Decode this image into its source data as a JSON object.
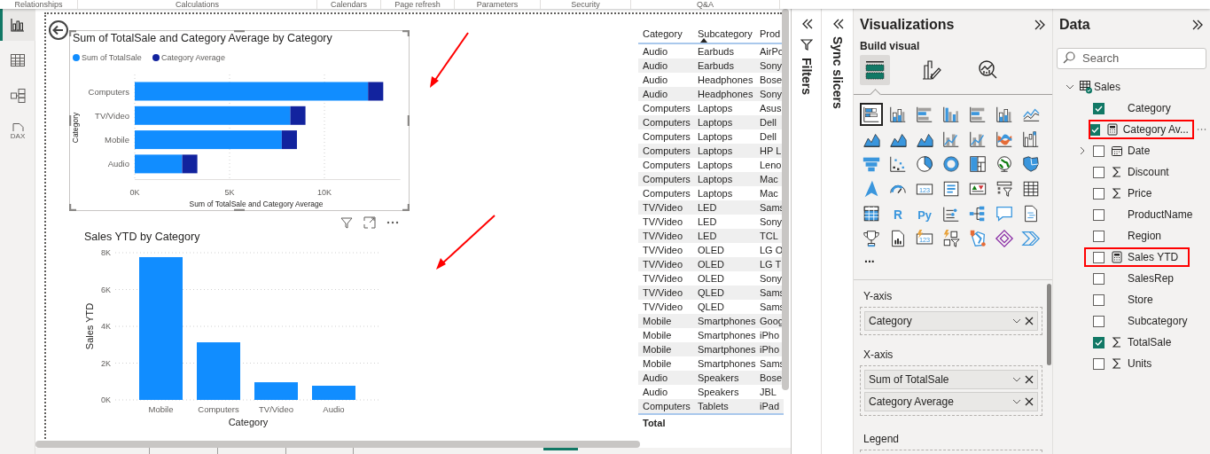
{
  "ribbon_groups": [
    "Relationships",
    "Calculations",
    "Calendars",
    "Page refresh",
    "Parameters",
    "Security",
    "Q&A"
  ],
  "nav": [
    {
      "kind": "report",
      "selected": true
    },
    {
      "kind": "table",
      "selected": false
    },
    {
      "kind": "model",
      "selected": false
    },
    {
      "kind": "dax",
      "label": "DAX",
      "selected": false
    }
  ],
  "report": {
    "visuals": [
      {
        "selected": true,
        "hovered": false,
        "chart_data": {
          "type": "bar",
          "orientation": "horizontal",
          "stacked": true,
          "legend": true,
          "grid": true,
          "xlim": [
            0,
            14000
          ],
          "title": "Sum of TotalSale and Category Average by Category",
          "xlabel": "Sum of TotalSale and Category Average",
          "ylabel": "Category",
          "categories": [
            "Computers",
            "TV/Video",
            "Mobile",
            "Audio"
          ],
          "series": [
            {
              "name": "Sum of TotalSale",
              "color": "#118dff",
              "values": [
                12300,
                8200,
                7750,
                2500
              ]
            },
            {
              "name": "Category Average",
              "color": "#12239e",
              "values": [
                800,
                800,
                800,
                800
              ]
            }
          ],
          "xticks": [
            {
              "value": 0,
              "label": "0K"
            },
            {
              "value": 5000,
              "label": "5K"
            },
            {
              "value": 10000,
              "label": "10K"
            }
          ]
        }
      },
      {
        "selected": false,
        "hovered": true,
        "chart_data": {
          "type": "bar",
          "orientation": "vertical",
          "grid": true,
          "ylim": [
            0,
            8000
          ],
          "title": "Sales YTD by Category",
          "xlabel": "Category",
          "ylabel": "Sales YTD",
          "categories": [
            "Mobile",
            "Computers",
            "TV/Video",
            "Audio"
          ],
          "values": [
            7760,
            3130,
            960,
            770
          ],
          "yticks": [
            {
              "value": 0,
              "label": "0K"
            },
            {
              "value": 2000,
              "label": "2K"
            },
            {
              "value": 4000,
              "label": "4K"
            },
            {
              "value": 6000,
              "label": "6K"
            },
            {
              "value": 8000,
              "label": "8K"
            }
          ]
        }
      }
    ],
    "table": {
      "columns": [
        {
          "label": "Category",
          "sorted": false
        },
        {
          "label": "Subcategory",
          "sorted": true
        },
        {
          "label": "Prod",
          "sorted": false
        }
      ],
      "rows": [
        [
          "Audio",
          "Earbuds",
          "AirPo"
        ],
        [
          "Audio",
          "Earbuds",
          "Sony"
        ],
        [
          "Audio",
          "Headphones",
          "Bose"
        ],
        [
          "Audio",
          "Headphones",
          "Sony"
        ],
        [
          "Computers",
          "Laptops",
          "Asus"
        ],
        [
          "Computers",
          "Laptops",
          "Dell"
        ],
        [
          "Computers",
          "Laptops",
          "Dell"
        ],
        [
          "Computers",
          "Laptops",
          "HP L"
        ],
        [
          "Computers",
          "Laptops",
          "Leno"
        ],
        [
          "Computers",
          "Laptops",
          "Mac"
        ],
        [
          "Computers",
          "Laptops",
          "Mac"
        ],
        [
          "TV/Video",
          "LED",
          "Sams"
        ],
        [
          "TV/Video",
          "LED",
          "Sony"
        ],
        [
          "TV/Video",
          "LED",
          "TCL"
        ],
        [
          "TV/Video",
          "OLED",
          "LG O"
        ],
        [
          "TV/Video",
          "OLED",
          "LG T"
        ],
        [
          "TV/Video",
          "OLED",
          "Sony"
        ],
        [
          "TV/Video",
          "QLED",
          "Sams"
        ],
        [
          "TV/Video",
          "QLED",
          "Sams"
        ],
        [
          "Mobile",
          "Smartphones",
          "Goog"
        ],
        [
          "Mobile",
          "Smartphones",
          "iPho"
        ],
        [
          "Mobile",
          "Smartphones",
          "iPho"
        ],
        [
          "Mobile",
          "Smartphones",
          "Sams"
        ],
        [
          "Audio",
          "Speakers",
          "Bose"
        ],
        [
          "Audio",
          "Speakers",
          "JBL"
        ],
        [
          "Computers",
          "Tablets",
          "iPad"
        ]
      ],
      "total_label": "Total"
    }
  },
  "filters_pane": {
    "title": "Filters"
  },
  "sync_slicers_pane": {
    "title": "Sync slicers"
  },
  "visualizations": {
    "title": "Visualizations",
    "subtitle": "Build visual",
    "tabs": [
      {
        "kind": "fields",
        "selected": true
      },
      {
        "kind": "format",
        "selected": false
      },
      {
        "kind": "analytics",
        "selected": false
      }
    ],
    "visual_types": [
      {
        "kind": "stacked-bar-chart",
        "selected": true
      },
      {
        "kind": "stacked-column-chart",
        "selected": false
      },
      {
        "kind": "clustered-bar-chart",
        "selected": false
      },
      {
        "kind": "clustered-column-chart",
        "selected": false
      },
      {
        "kind": "percent-bar-chart",
        "selected": false
      },
      {
        "kind": "percent-column-chart",
        "selected": false
      },
      {
        "kind": "line-chart",
        "selected": false
      },
      {
        "kind": "area-chart",
        "selected": false
      },
      {
        "kind": "stacked-area-chart",
        "selected": false
      },
      {
        "kind": "percent-area-chart",
        "selected": false
      },
      {
        "kind": "line-column-chart",
        "selected": false
      },
      {
        "kind": "line-stacked-column-chart",
        "selected": false
      },
      {
        "kind": "ribbon-chart",
        "selected": false
      },
      {
        "kind": "waterfall-chart",
        "selected": false
      },
      {
        "kind": "funnel-chart",
        "selected": false
      },
      {
        "kind": "scatter-chart",
        "selected": false
      },
      {
        "kind": "pie-chart",
        "selected": false
      },
      {
        "kind": "donut-chart",
        "selected": false
      },
      {
        "kind": "treemap",
        "selected": false
      },
      {
        "kind": "globe",
        "selected": false
      },
      {
        "kind": "filled-map",
        "selected": false
      },
      {
        "kind": "navigation-arrow",
        "selected": false
      },
      {
        "kind": "gauge",
        "selected": false
      },
      {
        "kind": "card",
        "label": "123",
        "selected": false
      },
      {
        "kind": "multi-row-card",
        "selected": false
      },
      {
        "kind": "kpi",
        "selected": false
      },
      {
        "kind": "slicer",
        "selected": false
      },
      {
        "kind": "table",
        "selected": false
      },
      {
        "kind": "matrix",
        "selected": false
      },
      {
        "kind": "r-script",
        "label": "R",
        "selected": false
      },
      {
        "kind": "python-script",
        "label": "Py",
        "selected": false
      },
      {
        "kind": "key-influencers",
        "selected": false
      },
      {
        "kind": "decomposition-tree",
        "selected": false
      },
      {
        "kind": "speech-bubble",
        "selected": false
      },
      {
        "kind": "narrative",
        "selected": false
      },
      {
        "kind": "trophy",
        "selected": false
      },
      {
        "kind": "paginated-report",
        "selected": false
      },
      {
        "kind": "smart-card",
        "label": "123",
        "selected": false
      },
      {
        "kind": "smart-slicer",
        "selected": false
      },
      {
        "kind": "map-pin",
        "selected": false
      },
      {
        "kind": "diamond",
        "selected": false
      },
      {
        "kind": "chevrons",
        "selected": false
      }
    ],
    "more": "...",
    "wells": [
      {
        "label": "Y-axis",
        "fields": [
          "Category"
        ]
      },
      {
        "label": "X-axis",
        "fields": [
          "Sum of TotalSale",
          "Category Average"
        ]
      },
      {
        "label": "Legend"
      }
    ]
  },
  "data": {
    "title": "Data",
    "search": {
      "placeholder": "Search"
    },
    "tables": [
      {
        "name": "Sales",
        "expanded": true,
        "fields": [
          {
            "name": "Category",
            "kind": "text",
            "checked": true,
            "highlighted": false,
            "hovered": false
          },
          {
            "name": "Category Av...",
            "kind": "measure",
            "checked": true,
            "highlighted": true,
            "hovered": true
          },
          {
            "name": "Date",
            "kind": "date",
            "checked": false,
            "highlighted": false,
            "hovered": false
          },
          {
            "name": "Discount",
            "kind": "sum",
            "checked": false,
            "highlighted": false,
            "hovered": false
          },
          {
            "name": "Price",
            "kind": "sum",
            "checked": false,
            "highlighted": false,
            "hovered": false
          },
          {
            "name": "ProductName",
            "kind": "text",
            "checked": false,
            "highlighted": false,
            "hovered": false
          },
          {
            "name": "Region",
            "kind": "text",
            "checked": false,
            "highlighted": false,
            "hovered": false
          },
          {
            "name": "Sales YTD",
            "kind": "measure",
            "checked": false,
            "highlighted": true,
            "hovered": false
          },
          {
            "name": "SalesRep",
            "kind": "text",
            "checked": false,
            "highlighted": false,
            "hovered": false
          },
          {
            "name": "Store",
            "kind": "text",
            "checked": false,
            "highlighted": false,
            "hovered": false
          },
          {
            "name": "Subcategory",
            "kind": "text",
            "checked": false,
            "highlighted": false,
            "hovered": false
          },
          {
            "name": "TotalSale",
            "kind": "sum",
            "checked": true,
            "highlighted": false,
            "hovered": false
          },
          {
            "name": "Units",
            "kind": "sum",
            "checked": false,
            "highlighted": false,
            "hovered": false
          }
        ]
      }
    ]
  }
}
